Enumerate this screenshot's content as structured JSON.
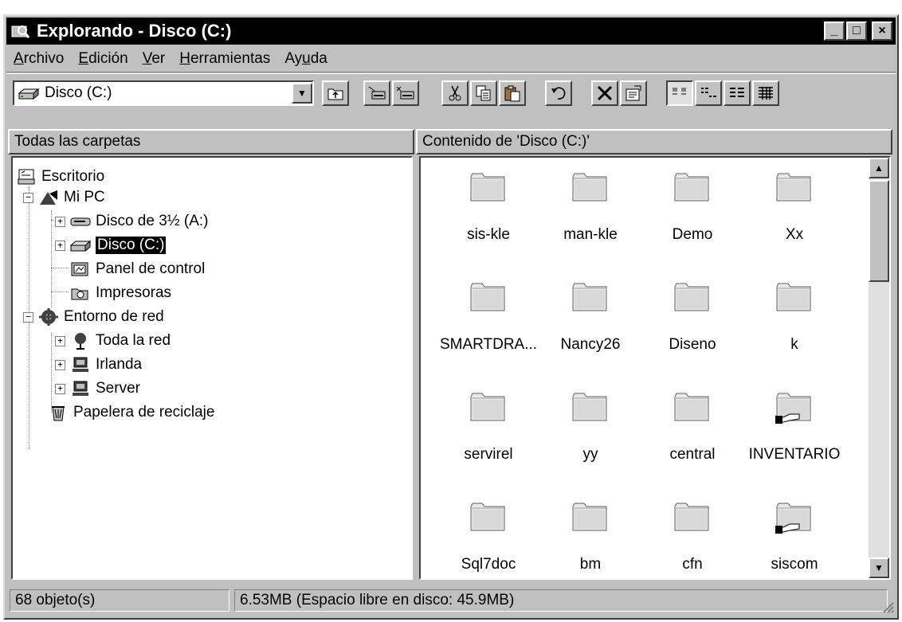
{
  "window": {
    "title": "Explorando - Disco (C:)",
    "controls": {
      "minimize": "_",
      "maximize": "□",
      "close": "×"
    }
  },
  "menu": [
    {
      "accel": "A",
      "rest": "rchivo"
    },
    {
      "accel": "E",
      "rest": "dición"
    },
    {
      "accel": "V",
      "rest": "er"
    },
    {
      "accel": "H",
      "rest": "erramientas"
    },
    {
      "pre": "Ay",
      "accel": "u",
      "rest": "da"
    }
  ],
  "toolbar": {
    "address_value": "Disco (C:)",
    "buttons": [
      "up-folder-icon",
      "map-drive-icon",
      "disconnect-drive-icon",
      "cut-icon",
      "copy-icon",
      "paste-icon",
      "undo-icon",
      "delete-icon",
      "properties-icon",
      "large-icons-view-icon",
      "small-icons-view-icon",
      "list-view-icon",
      "details-view-icon"
    ]
  },
  "panes": {
    "left_header": "Todas las carpetas",
    "right_header": "Contenido de 'Disco (C:)'"
  },
  "tree": {
    "desktop": "Escritorio",
    "my_pc": "Mi PC",
    "floppy": "Disco de 3½ (A:)",
    "drive_c": "Disco (C:)",
    "control_panel": "Panel de control",
    "printers": "Impresoras",
    "network": "Entorno de red",
    "entire_network": "Toda la red",
    "irlanda": "Irlanda",
    "server": "Server",
    "recycle_bin": "Papelera de reciclaje"
  },
  "items": [
    {
      "label": "sis-kle",
      "shared": false
    },
    {
      "label": "man-kle",
      "shared": false
    },
    {
      "label": "Demo",
      "shared": false
    },
    {
      "label": "Xx",
      "shared": false
    },
    {
      "label": "SMARTDRA...",
      "shared": false
    },
    {
      "label": "Nancy26",
      "shared": false
    },
    {
      "label": "Diseno",
      "shared": false
    },
    {
      "label": "k",
      "shared": false
    },
    {
      "label": "servirel",
      "shared": false
    },
    {
      "label": "yy",
      "shared": false
    },
    {
      "label": "central",
      "shared": false
    },
    {
      "label": "INVENTARIO",
      "shared": true
    },
    {
      "label": "Sql7doc",
      "shared": false
    },
    {
      "label": "bm",
      "shared": false
    },
    {
      "label": "cfn",
      "shared": false
    },
    {
      "label": "siscom",
      "shared": true
    }
  ],
  "status": {
    "objects": "68 objeto(s)",
    "space": "6.53MB (Espacio libre en disco: 45.9MB)"
  }
}
